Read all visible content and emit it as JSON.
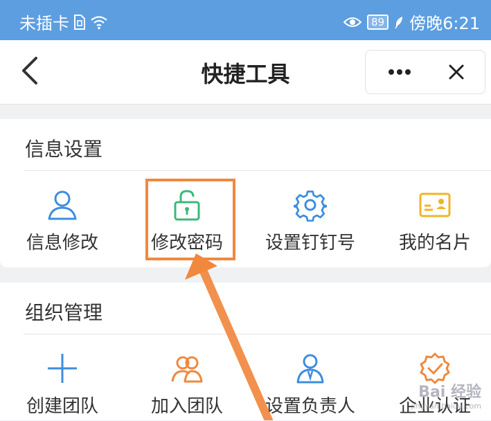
{
  "status_bar": {
    "carrier": "未插卡",
    "battery": "89",
    "time": "傍晚6:21",
    "bg_color": "#5c9ee0"
  },
  "header": {
    "title": "快捷工具",
    "back_icon": "chevron-left-icon",
    "more_icon": "more-dots-icon",
    "close_icon": "close-icon"
  },
  "sections": [
    {
      "title": "信息设置",
      "items": [
        {
          "label": "信息修改",
          "icon": "person-icon",
          "color": "#3d8de0"
        },
        {
          "label": "修改密码",
          "icon": "unlock-icon",
          "color": "#3cb878"
        },
        {
          "label": "设置钉钉号",
          "icon": "gear-icon",
          "color": "#3d8de0"
        },
        {
          "label": "我的名片",
          "icon": "card-icon",
          "color": "#f0b429"
        }
      ]
    },
    {
      "title": "组织管理",
      "items": [
        {
          "label": "创建团队",
          "icon": "plus-icon",
          "color": "#3d8de0"
        },
        {
          "label": "加入团队",
          "icon": "group-icon",
          "color": "#f0883e"
        },
        {
          "label": "设置负责人",
          "icon": "manager-icon",
          "color": "#3d8de0"
        },
        {
          "label": "企业认证",
          "icon": "certified-badge-icon",
          "color": "#f0883e"
        }
      ]
    }
  ],
  "annotation": {
    "highlight_color": "#f0883e"
  },
  "watermark": {
    "text": "Bai 经验",
    "sub": "jingyan.baidu.com"
  }
}
